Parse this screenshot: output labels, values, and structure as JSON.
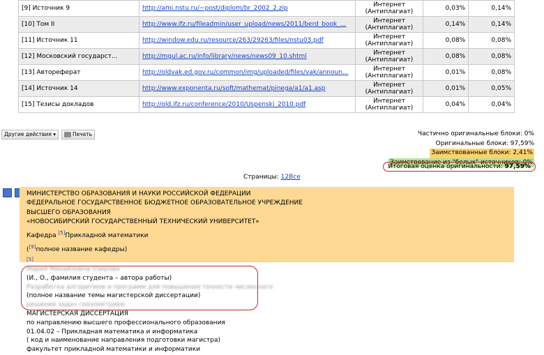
{
  "rows": [
    {
      "name": "[9] Источник 9",
      "url": "http://ami.nstu.ru/~post/diplom/br_2002_2.zip",
      "src": "Интернет (Антиплагиат)",
      "p1": "0,03%",
      "p2": "0,14%"
    },
    {
      "name": "[10] Том II",
      "url": "http://www.ifz.ru/fileadmin/user_upload/news/2011/berd_book_...",
      "src": "Интернет (Антиплагиат)",
      "p1": "0,14%",
      "p2": "0,14%"
    },
    {
      "name": "[11] Источник 11",
      "url": "http://window.edu.ru/resource/263/29263/files/nstu03.pdf",
      "src": "Интернет (Антиплагиат)",
      "p1": "0,08%",
      "p2": "0,08%"
    },
    {
      "name": "[12] Московский государст...",
      "url": "http://mgul.ac.ru/info/library/news/news09_10.shtml",
      "src": "Интернет (Антиплагиат)",
      "p1": "0,08%",
      "p2": "0,08%"
    },
    {
      "name": "[13] Автореферат",
      "url": "http://oldvak.ed.gov.ru/common/img/uploaded/files/vak/announ...",
      "src": "Интернет (Антиплагиат)",
      "p1": "0,01%",
      "p2": "0,08%"
    },
    {
      "name": "[14] Источник 14",
      "url": "http://www.exponenta.ru/soft/mathemat/pinega/a1/a1.asp",
      "src": "Интернет (Антиплагиат)",
      "p1": "0,01%",
      "p2": "0,05%"
    },
    {
      "name": "[15] Тезисы докладов",
      "url": "http://old.ifz.ru/conference/2010/Uspenski_2010.pdf",
      "src": "Интернет (Антиплагиат)",
      "p1": "0,04%",
      "p2": "0,04%"
    }
  ],
  "toolbar": {
    "other_actions": "Другие действия ▾",
    "print": "Печать"
  },
  "stats": {
    "partial": "Частично оригинальные блоки: 0%",
    "original": "Оригинальные блоки: 97,59%",
    "borrowed": "Заимствованные блоки: 2,41%",
    "white": "Заимствование из \"белых\" источников: 0%",
    "total_label": "Итоговая оценка оригинальности: ",
    "total_value": "97,59%"
  },
  "pages": {
    "label": "Страницы: ",
    "links": "12Все"
  },
  "doc": {
    "l1": "МИНИСТЕРСТВО ОБРАЗОВАНИЯ И НАУКИ РОССИЙСКОЙ ФЕДЕРАЦИИ",
    "l2": "ФЕДЕРАЛЬНОЕ ГОСУДАРСТВЕННОЕ БЮДЖЕТНОЕ ОБРАЗОВАТЕЛЬНОЕ УЧРЕЖДЕНИЕ",
    "l3": "ВЫСШЕГО ОБРАЗОВАНИЯ",
    "l4": "«НОВОСИБИРСКИЙ ГОСУДАРСТВЕННЫЙ ТЕХНИЧЕСКИЙ УНИВЕРСИТЕТ»",
    "l5a": "Кафедра ",
    "ref5": "[5]",
    "l5b": "Прикладной математики",
    "l6a": "(",
    "ref9": "[9]",
    "l6b": "полное название кафедры)",
    "ref5b": "[5]",
    "blur1": "Мария Михайловна Озерова",
    "l7": "(И., О., фамилия студента – автора работы)",
    "blur2": "Разработка алгоритмов и программ для повышения точности численного",
    "l8": "(полное название темы магистерской диссертации)",
    "blur3": "решения задач геоэлектрики",
    "l9": "МАГИСТЕРСКАЯ ДИССЕРТАЦИЯ",
    "l10": "по направлению высшего профессионального образования",
    "l11": "01.04.02 – Прикладная математика и информатика",
    "l12": "( код и наименование направления подготовки магистра)",
    "l13": "факультет прикладной математики и информатики"
  }
}
